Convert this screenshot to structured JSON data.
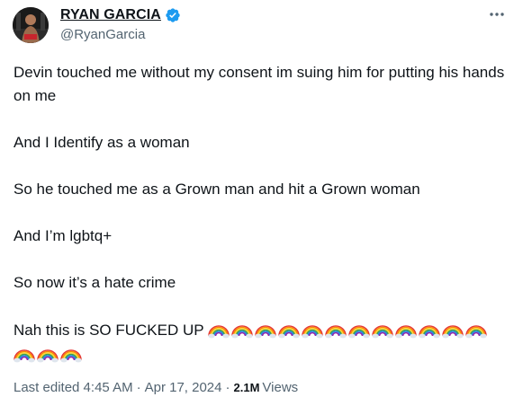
{
  "author": {
    "display_name": "RYAN GARCIA",
    "handle": "@RyanGarcia",
    "verified": true,
    "verified_color": "#1d9bf0"
  },
  "tweet": {
    "paragraphs": [
      "Devin touched me without my consent im suing him for putting his hands on me",
      "And I Identify as a woman",
      "So he touched me as a Grown man and hit a Grown woman",
      "And I’m lgbtq+",
      "So now it’s a hate crime",
      "Nah this is SO FUCKED UP"
    ],
    "rainbow_emoji_count": 15
  },
  "meta": {
    "edited_label": "Last edited 4:45 AM",
    "separator": "·",
    "date": "Apr 17, 2024",
    "views_count": "2.1M",
    "views_label": "Views"
  },
  "colors": {
    "text": "#0f1419",
    "secondary": "#536471",
    "background": "#ffffff"
  },
  "icons": {
    "more": "more-horizontal-icon",
    "verified": "verified-badge-icon",
    "emoji": "rainbow-emoji-icon"
  }
}
